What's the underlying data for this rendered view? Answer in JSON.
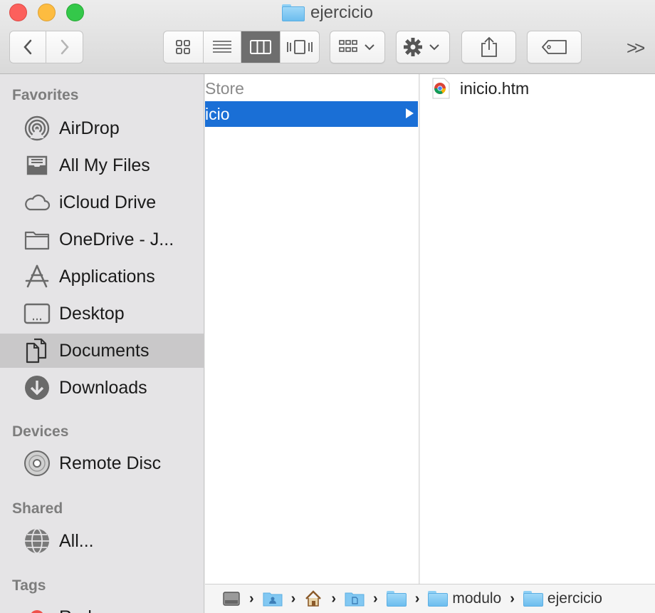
{
  "window": {
    "title": "ejercicio"
  },
  "toolbar": {
    "view_modes": [
      "icon-view",
      "list-view",
      "column-view",
      "cover-flow-view"
    ],
    "active_view": "column-view",
    "overflow_label": ">>"
  },
  "sidebar": {
    "favorites_title": "Favorites",
    "favorites": [
      {
        "label": "AirDrop",
        "icon": "airdrop-icon"
      },
      {
        "label": "All My Files",
        "icon": "all-my-files-icon"
      },
      {
        "label": "iCloud Drive",
        "icon": "cloud-icon"
      },
      {
        "label": "OneDrive - J...",
        "icon": "folder-icon"
      },
      {
        "label": "Applications",
        "icon": "applications-icon"
      },
      {
        "label": "Desktop",
        "icon": "desktop-icon"
      },
      {
        "label": "Documents",
        "icon": "documents-icon",
        "selected": true
      },
      {
        "label": "Downloads",
        "icon": "downloads-icon"
      }
    ],
    "devices_title": "Devices",
    "devices": [
      {
        "label": "Remote Disc",
        "icon": "disc-icon"
      }
    ],
    "shared_title": "Shared",
    "shared": [
      {
        "label": "All...",
        "icon": "network-icon"
      }
    ],
    "tags_title": "Tags",
    "tags": [
      {
        "label": "Red",
        "color": "#f0504a"
      }
    ]
  },
  "columns": {
    "col1": [
      {
        "label": "Store",
        "state": "dim"
      },
      {
        "label": "icio",
        "state": "selected"
      }
    ],
    "col2": [
      {
        "label": "inicio.htm",
        "icon": "chrome-file-icon"
      }
    ]
  },
  "pathbar": {
    "items": [
      {
        "label": "",
        "icon": "hard-drive-icon"
      },
      {
        "label": "",
        "icon": "user-folder-icon"
      },
      {
        "label": "",
        "icon": "home-icon"
      },
      {
        "label": "",
        "icon": "documents-folder-icon"
      },
      {
        "label": "",
        "icon": "folder-icon"
      },
      {
        "label": "modulo",
        "icon": "folder-icon"
      },
      {
        "label": "ejercicio",
        "icon": "folder-icon"
      }
    ]
  },
  "colors": {
    "selection": "#1a6fd6",
    "sidebar_bg": "#e5e4e6",
    "sidebar_selected": "#c9c8c9",
    "folder_blue": "#6cbdee"
  }
}
